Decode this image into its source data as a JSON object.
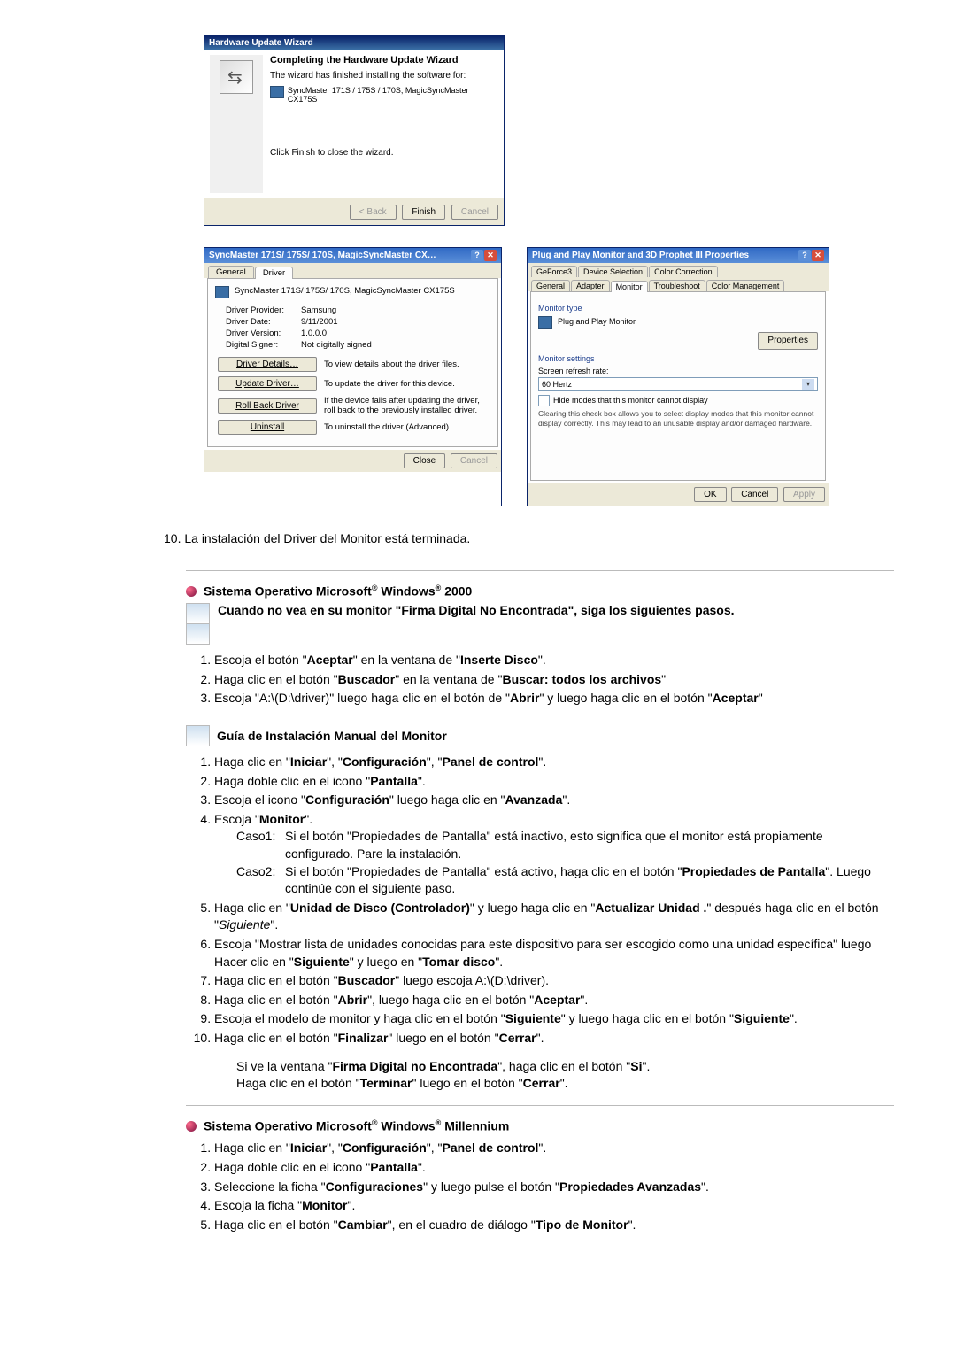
{
  "wizard": {
    "title": "Hardware Update Wizard",
    "heading": "Completing the Hardware Update Wizard",
    "line1": "The wizard has finished installing the software for:",
    "device": "SyncMaster 171S / 175S / 170S, MagicSyncMaster CX175S",
    "clickFinish": "Click Finish to close the wizard.",
    "back": "< Back",
    "finish": "Finish",
    "cancel": "Cancel"
  },
  "props": {
    "title": "SyncMaster 171S/ 175S/ 170S, MagicSyncMaster CX…",
    "tabGeneral": "General",
    "tabDriver": "Driver",
    "device": "SyncMaster 171S/ 175S/ 170S, MagicSyncMaster CX175S",
    "provLbl": "Driver Provider:",
    "provVal": "Samsung",
    "dateLbl": "Driver Date:",
    "dateVal": "9/11/2001",
    "verLbl": "Driver Version:",
    "verVal": "1.0.0.0",
    "sigLbl": "Digital Signer:",
    "sigVal": "Not digitally signed",
    "btnDetails": "Driver Details…",
    "btnDetailsDesc": "To view details about the driver files.",
    "btnUpdate": "Update Driver…",
    "btnUpdateDesc": "To update the driver for this device.",
    "btnRoll": "Roll Back Driver",
    "btnRollDesc": "If the device fails after updating the driver, roll back to the previously installed driver.",
    "btnUninst": "Uninstall",
    "btnUninstDesc": "To uninstall the driver (Advanced).",
    "close": "Close",
    "cancel": "Cancel"
  },
  "pnp": {
    "title": "Plug and Play Monitor and 3D Prophet III Properties",
    "tabs1": [
      "GeForce3",
      "Device Selection",
      "Color Correction"
    ],
    "tabs2": [
      "General",
      "Adapter",
      "Monitor",
      "Troubleshoot",
      "Color Management"
    ],
    "grpType": "Monitor type",
    "monName": "Plug and Play Monitor",
    "properties": "Properties",
    "grpSettings": "Monitor settings",
    "refreshLbl": "Screen refresh rate:",
    "refreshVal": "60 Hertz",
    "hide": "Hide modes that this monitor cannot display",
    "hideHelp": "Clearing this check box allows you to select display modes that this monitor cannot display correctly. This may lead to an unusable display and/or damaged hardware.",
    "ok": "OK",
    "cancel": "Cancel",
    "apply": "Apply"
  },
  "doc": {
    "step10": "10.  La instalación del Driver del Monitor está terminada.",
    "w2000": {
      "titleA": "Sistema Operativo Microsoft",
      "titleB": " Windows",
      "titleC": " 2000",
      "sig": "Cuando no vea en su monitor \"Firma Digital No Encontrada\", siga los siguientes pasos.",
      "s1a": "Escoja el botón \"",
      "s1b": "Aceptar",
      "s1c": "\" en la ventana de \"",
      "s1d": "Inserte Disco",
      "s1e": "\".",
      "s2a": "Haga clic en el botón \"",
      "s2b": "Buscador",
      "s2c": "\" en la ventana de \"",
      "s2d": "Buscar: todos los archivos",
      "s2e": "\"",
      "s3a": "Escoja \"A:\\(D:\\driver)\" luego haga clic en el botón de \"",
      "s3b": "Abrir",
      "s3c": "\" y luego haga clic en el botón \"",
      "s3d": "Aceptar",
      "s3e": "\""
    },
    "manual": {
      "title": "Guía de Instalación Manual del Monitor",
      "s1a": "Haga clic en \"",
      "s1b": "Iniciar",
      "s1c": "\", \"",
      "s1d": "Configuración",
      "s1e": "\", \"",
      "s1f": "Panel de control",
      "s1g": "\".",
      "s2a": "Haga doble clic en el icono \"",
      "s2b": "Pantalla",
      "s2c": "\".",
      "s3a": "Escoja el icono \"",
      "s3b": "Configuración",
      "s3c": "\" luego haga clic en \"",
      "s3d": "Avanzada",
      "s3e": "\".",
      "s4a": "Escoja \"",
      "s4b": "Monitor",
      "s4c": "\".",
      "c1t": "Caso1:",
      "c1": "Si el botón \"Propiedades de Pantalla\" está inactivo, esto significa que el monitor está propiamente configurado. Pare la instalación.",
      "c2t": "Caso2:",
      "c2a": "Si el botón \"Propiedades de Pantalla\" está activo, haga clic en el botón \"",
      "c2b": "Propiedades de Pantalla",
      "c2c": "\". Luego continúe con el siguiente paso.",
      "s5a": "Haga clic en \"",
      "s5b": "Unidad de Disco (Controlador)",
      "s5c": "\" y luego haga clic en \"",
      "s5d": "Actualizar Unidad .",
      "s5e": "\" después haga clic en el botón \"",
      "s5f": "Siguiente",
      "s5g": "\".",
      "s6a": "Escoja \"Mostrar lista de unidades conocidas para este dispositivo para ser escogido como una unidad específica\" luego Hacer clic en \"",
      "s6b": "Siguiente",
      "s6c": "\" y luego en \"",
      "s6d": "Tomar disco",
      "s6e": "\".",
      "s7a": "Haga clic en el botón \"",
      "s7b": "Buscador",
      "s7c": "\" luego escoja A:\\(D:\\driver).",
      "s8a": "Haga clic en el botón \"",
      "s8b": "Abrir",
      "s8c": "\", luego haga clic en el botón \"",
      "s8d": "Aceptar",
      "s8e": "\".",
      "s9a": "Escoja el modelo de monitor y haga clic en el botón \"",
      "s9b": "Siguiente",
      "s9c": "\" y luego haga clic en el botón \"",
      "s9d": "Siguiente",
      "s9e": "\".",
      "s10a": "Haga clic en el botón \"",
      "s10b": "Finalizar",
      "s10c": "\" luego en el botón \"",
      "s10d": "Cerrar",
      "s10e": "\".",
      "extra1a": "Si ve la ventana \"",
      "extra1b": "Firma Digital no Encontrada",
      "extra1c": "\", haga clic en el botón \"",
      "extra1d": "Si",
      "extra1e": "\".",
      "extra2a": "Haga clic en el botón \"",
      "extra2b": "Terminar",
      "extra2c": "\" luego en el botón \"",
      "extra2d": "Cerrar",
      "extra2e": "\"."
    },
    "wme": {
      "titleA": "Sistema Operativo Microsoft",
      "titleB": " Windows",
      "titleC": " Millennium",
      "s1a": "Haga clic en \"",
      "s1b": "Iniciar",
      "s1c": "\", \"",
      "s1d": "Configuración",
      "s1e": "\", \"",
      "s1f": "Panel de control",
      "s1g": "\".",
      "s2a": "Haga doble clic en el icono \"",
      "s2b": "Pantalla",
      "s2c": "\".",
      "s3a": "Seleccione la ficha \"",
      "s3b": "Configuraciones",
      "s3c": "\" y luego pulse el botón \"",
      "s3d": "Propiedades Avanzadas",
      "s3e": "\".",
      "s4a": "Escoja la ficha \"",
      "s4b": "Monitor",
      "s4c": "\".",
      "s5a": "Haga clic en el botón \"",
      "s5b": "Cambiar",
      "s5c": "\", en el cuadro de diálogo \"",
      "s5d": "Tipo de Monitor",
      "s5e": "\"."
    }
  }
}
